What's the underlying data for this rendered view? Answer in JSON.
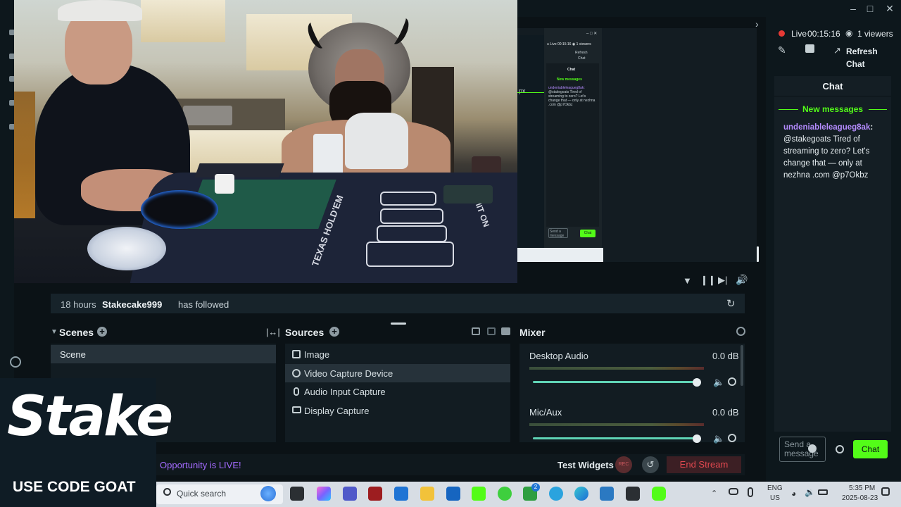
{
  "live": {
    "status": "Live",
    "timer": "00:15:16",
    "viewers": "1 viewers"
  },
  "toolbar": {
    "refresh_chat_line1": "Refresh",
    "refresh_chat_line2": "Chat"
  },
  "chat": {
    "title": "Chat",
    "new_messages_label": "New messages",
    "message_user": "undeniableleagueg8ak",
    "message_text": "@stakegoats Tired of streaming to zero? Let's change that — only at nezhna .com @p7Okbz",
    "input_placeholder": "Send a message",
    "send_button": "Chat"
  },
  "event": {
    "time": "18 hours",
    "user": "Stakecake999",
    "action": "has followed"
  },
  "scenes": {
    "title": "Scenes",
    "items": [
      "Scene"
    ]
  },
  "sources": {
    "title": "Sources",
    "items": [
      "Image",
      "Video Capture Device",
      "Audio Input Capture",
      "Display Capture"
    ],
    "selected_index": 1
  },
  "mixer": {
    "title": "Mixer",
    "channels": [
      {
        "name": "Desktop Audio",
        "level": "0.0 dB",
        "volume": 0.98
      },
      {
        "name": "Mic/Aux",
        "level": "0.0 dB",
        "volume": 0.98
      }
    ]
  },
  "bottom": {
    "announcement": "Opportunity is LIVE!",
    "test_widgets": "Test Widgets",
    "rec_label": "REC",
    "end_stream": "End Stream"
  },
  "overlay": {
    "brand": "Stake",
    "promo": "USE CODE GOAT"
  },
  "preview": {
    "live": "Live 00:15:16",
    "viewers": "1 viewers",
    "refresh": "Refresh",
    "refresh2": "Chat",
    "chat": "Chat",
    "new_messages": "New messages",
    "message_user": "undeniableleagueg8ak:",
    "message_text": "@stakegoats Tired of streaming to zero? Let's change that — only at nezhna .com @p7Okbz",
    "px_label": "px",
    "input": "Send a message",
    "send": "Chat"
  },
  "camera_scene": {
    "table_text_left": "TEXAS HOLD'EM",
    "table_text_right": "LIMIT ON"
  },
  "taskbar": {
    "search_placeholder": "Quick search",
    "lang_line1": "ENG",
    "lang_line2": "US",
    "time": "5:35 PM",
    "date": "2025-08-23",
    "badge_count": "2"
  },
  "colors": {
    "accent_green": "#53fc18",
    "live_red": "#e53935",
    "end_stream_red": "#e0484f",
    "chat_username_purple": "#b58cff",
    "announcement_purple": "#a46bff"
  }
}
